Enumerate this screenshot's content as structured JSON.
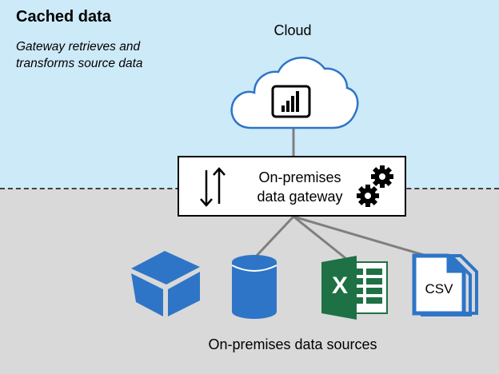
{
  "header": {
    "title": "Cached data",
    "subtitle_lines": [
      "Gateway retrieves and",
      "transforms source data"
    ]
  },
  "cloud": {
    "label": "Cloud",
    "icon": "power-bi-icon"
  },
  "gateway": {
    "label_lines": [
      "On-premises",
      "data gateway"
    ],
    "icons": [
      "up-down-arrows-icon",
      "gears-icon"
    ]
  },
  "sources": {
    "label": "On-premises data sources",
    "items": [
      {
        "name": "analysis-services-cube-icon"
      },
      {
        "name": "database-cylinder-icon"
      },
      {
        "name": "excel-icon",
        "text": "X"
      },
      {
        "name": "csv-file-icon",
        "text": "CSV"
      }
    ]
  },
  "colors": {
    "cloud_background": "#cdeaf8",
    "onprem_background": "#d9d9d9",
    "source_blue": "#2e75c7",
    "excel_green": "#1e7145",
    "connector_gray": "#7f7f7f"
  }
}
